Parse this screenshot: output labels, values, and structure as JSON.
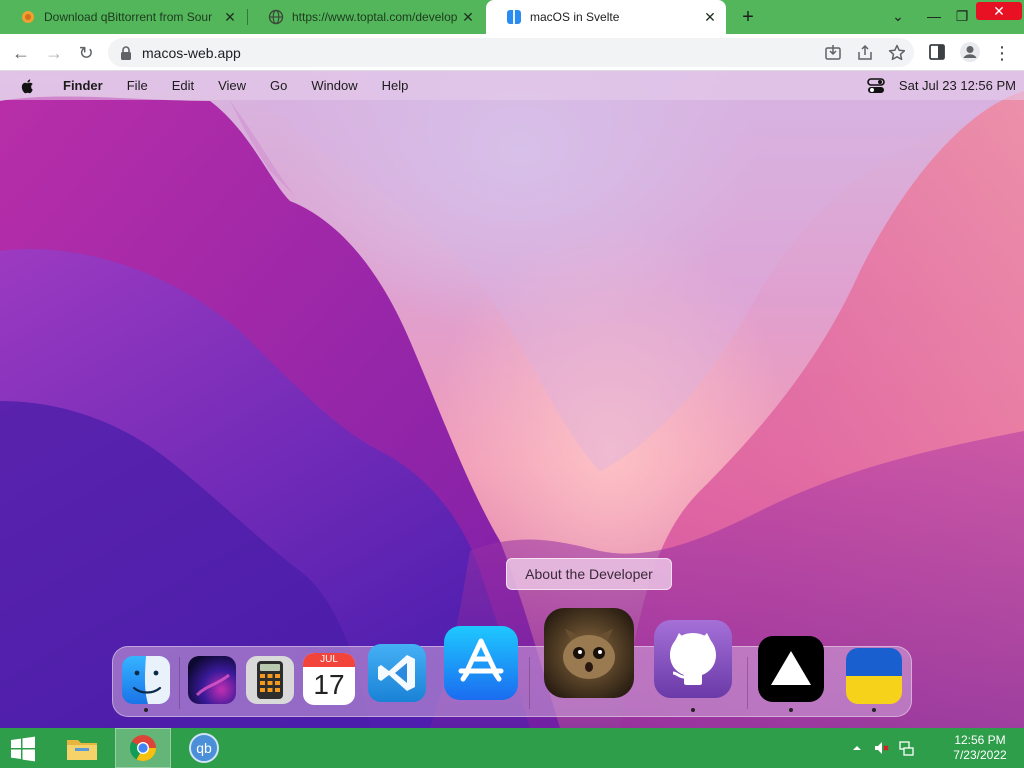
{
  "browser": {
    "tabs": [
      {
        "title": "Download qBittorrent from Sour",
        "icon": "sourceforge-icon"
      },
      {
        "title": "https://www.toptal.com/develop",
        "icon": "globe-icon"
      },
      {
        "title": "macOS in Svelte",
        "icon": "finder-favicon",
        "active": true
      }
    ],
    "url": "macos-web.app",
    "close_glyph": "✕",
    "new_tab_glyph": "+",
    "tab_list_glyph": "⌄",
    "minimize_glyph": "—",
    "restore_glyph": "❐",
    "back_glyph": "←",
    "forward_glyph": "→",
    "reload_glyph": "↻",
    "more_glyph": "⋮"
  },
  "macos": {
    "menu": {
      "app_name": "Finder",
      "items": [
        "File",
        "Edit",
        "View",
        "Go",
        "Window",
        "Help"
      ],
      "clock": "Sat Jul 23  12:56 PM"
    },
    "tooltip": "About the Developer",
    "dock": [
      {
        "name": "Finder",
        "icon": "finder-icon",
        "running": true
      },
      {
        "name": "Wallpapers",
        "icon": "wallpapers-icon",
        "running": false
      },
      {
        "name": "Calculator",
        "icon": "calculator-icon",
        "running": false
      },
      {
        "name": "Calendar",
        "icon": "calendar-icon",
        "running": false,
        "month": "JUL",
        "day": "17"
      },
      {
        "name": "VS Code",
        "icon": "vscode-icon",
        "running": false
      },
      {
        "name": "App Store",
        "icon": "appstore-icon",
        "running": false
      },
      {
        "name": "About the Developer",
        "icon": "developer-cat-icon",
        "running": false
      },
      {
        "name": "GitHub",
        "icon": "github-icon",
        "running": true
      },
      {
        "name": "Vercel",
        "icon": "vercel-icon",
        "running": true
      },
      {
        "name": "Ukraine",
        "icon": "ukraine-flag-icon",
        "running": true
      }
    ]
  },
  "taskbar": {
    "apps": [
      {
        "name": "File Explorer",
        "icon": "file-explorer-icon"
      },
      {
        "name": "Google Chrome",
        "icon": "chrome-icon",
        "active": true
      },
      {
        "name": "qBittorrent",
        "icon": "qbittorrent-icon",
        "label": "qb"
      }
    ],
    "time": "12:56 PM",
    "date": "7/23/2022"
  },
  "colors": {
    "chrome_frame": "#53b65b",
    "taskbar": "#2f9e4a",
    "close_button": "#e81123"
  }
}
